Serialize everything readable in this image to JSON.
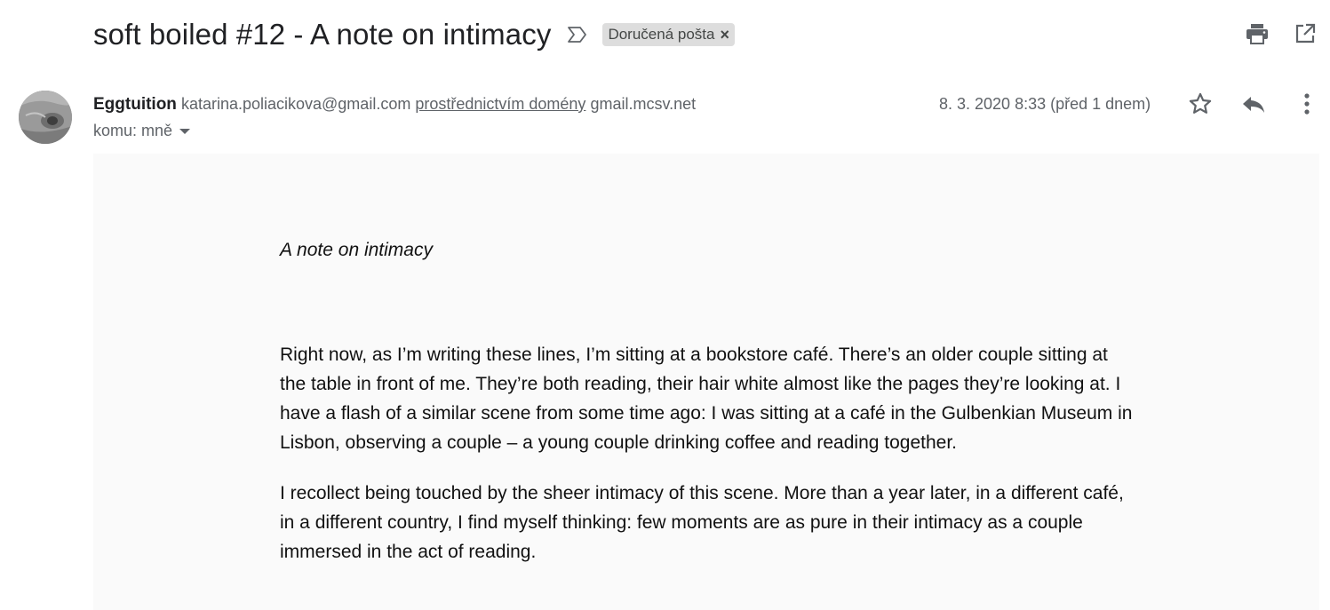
{
  "header": {
    "subject": "soft boiled #12 - A note on intimacy",
    "label": "Doručená pošta",
    "label_remove": "×",
    "icons": {
      "importance": "importance-marker-icon",
      "print": "print-icon",
      "open_new_window": "open-in-new-window-icon"
    }
  },
  "message": {
    "sender_name": "Eggtuition",
    "sender_email": "katarina.poliacikova@gmail.com",
    "via_text": "prostřednictvím domény",
    "via_domain": "gmail.mcsv.net",
    "to_text": "komu: mně",
    "date": "8. 3. 2020 8:33 (před 1 dnem)",
    "icons": {
      "star": "star-icon",
      "reply": "reply-icon",
      "more": "more-vertical-icon"
    }
  },
  "body": {
    "title": "A note on intimacy",
    "paragraphs": [
      "Right now, as I’m writing these lines, I’m sitting at a bookstore café. There’s an older couple sitting at the table in front of me. They’re both reading, their hair white almost like the pages they’re looking at. I have a flash of a similar scene from some time ago: I was sitting at a café in the Gulbenkian Museum in Lisbon, observing a couple – a young couple drinking coffee and reading together.",
      "I recollect being touched by the sheer intimacy of this scene. More than a year later, in a different café, in a different country, I find myself thinking: few moments are as pure in their intimacy as a couple immersed in the act of reading."
    ]
  },
  "colors": {
    "text_primary": "#202124",
    "text_secondary": "#5f6368",
    "label_bg": "#dddddd",
    "body_bg": "#fafafa"
  }
}
